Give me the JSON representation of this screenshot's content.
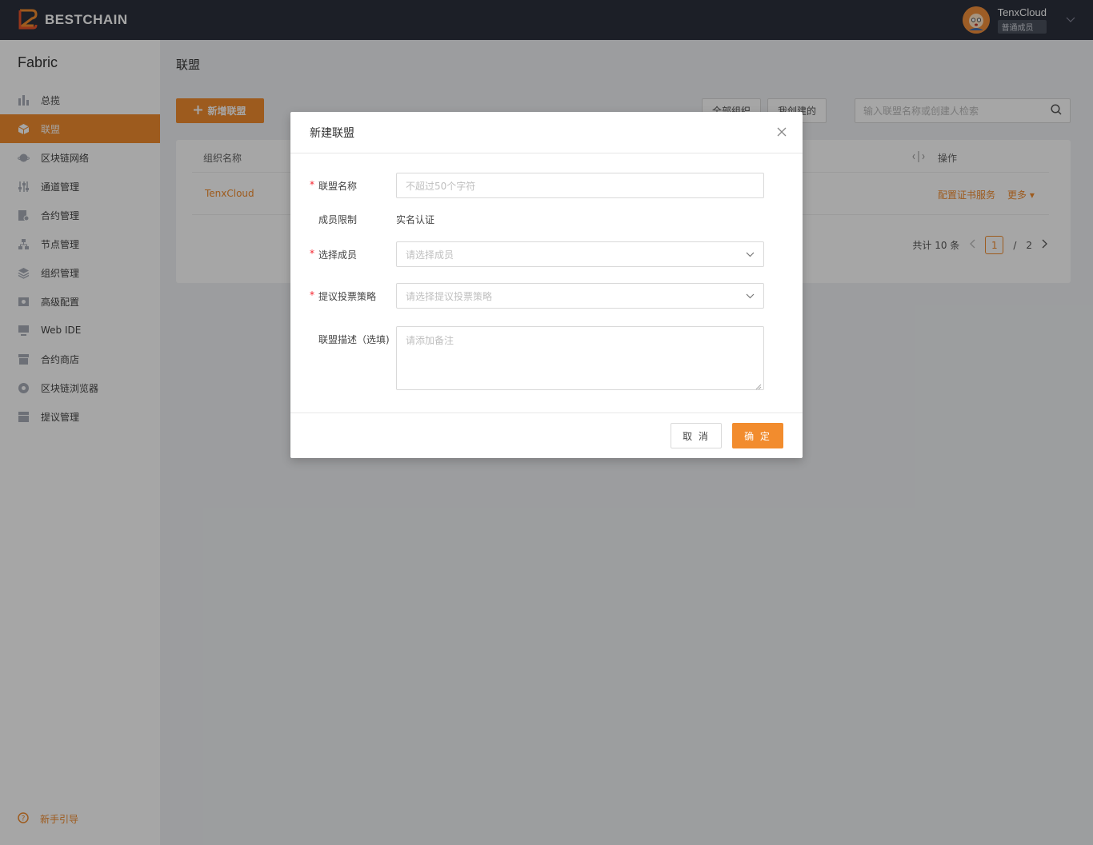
{
  "header": {
    "brand": "BESTCHAIN",
    "user_name": "TenxCloud",
    "user_role": "普通成员"
  },
  "sidebar": {
    "title": "Fabric",
    "items": [
      {
        "label": "总揽",
        "icon": "chart-bar-icon"
      },
      {
        "label": "联盟",
        "icon": "cube-icon"
      },
      {
        "label": "区块链网络",
        "icon": "planet-icon"
      },
      {
        "label": "通道管理",
        "icon": "sliders-icon"
      },
      {
        "label": "合约管理",
        "icon": "contract-icon"
      },
      {
        "label": "节点管理",
        "icon": "hierarchy-icon"
      },
      {
        "label": "组织管理",
        "icon": "layers-icon"
      },
      {
        "label": "高级配置",
        "icon": "config-icon"
      },
      {
        "label": "Web IDE",
        "icon": "monitor-icon"
      },
      {
        "label": "合约商店",
        "icon": "store-icon"
      },
      {
        "label": "区块链浏览器",
        "icon": "browser-icon"
      },
      {
        "label": "提议管理",
        "icon": "archive-icon"
      }
    ],
    "guide": "新手引导"
  },
  "main": {
    "title": "联盟",
    "add_button": "新增联盟",
    "filters": [
      "全部组织",
      "我创建的"
    ],
    "search_placeholder": "输入联盟名称或创建人检索",
    "table": {
      "col_org": "组织名称",
      "col_action": "操作",
      "rows": [
        {
          "org": "TenxCloud",
          "action1": "配置证书服务",
          "action2": "更多"
        }
      ]
    },
    "pager": {
      "total": "共计 10 条",
      "current": "1",
      "sep": "/",
      "pages": "2"
    }
  },
  "modal": {
    "title": "新建联盟",
    "name_label": "联盟名称",
    "name_placeholder": "不超过50个字符",
    "limit_label": "成员限制",
    "limit_value": "实名认证",
    "member_label": "选择成员",
    "member_placeholder": "请选择成员",
    "policy_label": "提议投票策略",
    "policy_placeholder": "请选择提议投票策略",
    "desc_label": "联盟描述（选填)",
    "desc_placeholder": "请添加备注",
    "cancel": "取 消",
    "ok": "确 定"
  },
  "colors": {
    "accent": "#f28c2e",
    "topbar": "#2b313d"
  }
}
